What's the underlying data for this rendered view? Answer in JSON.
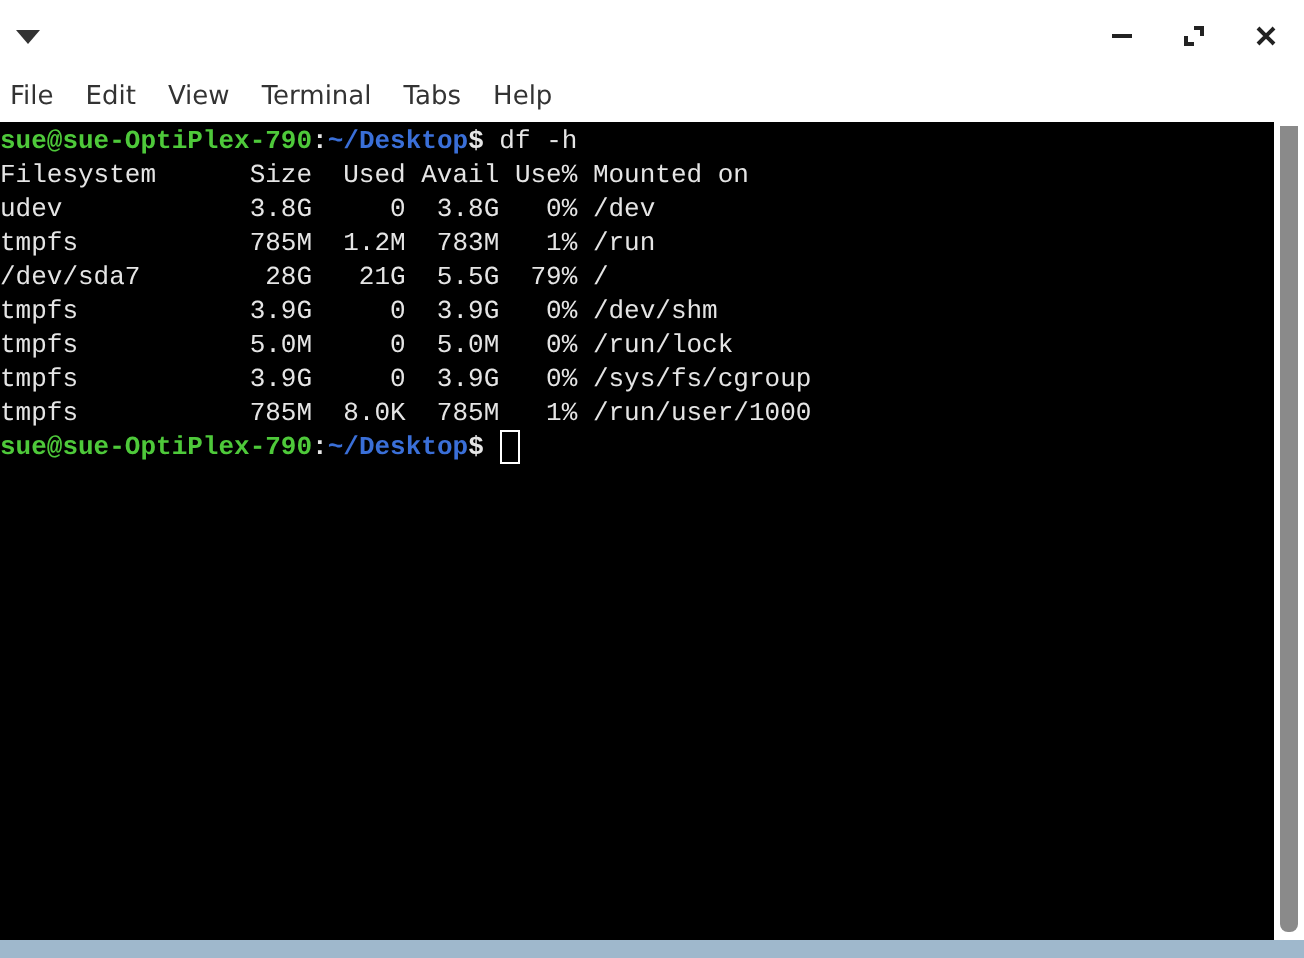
{
  "menu": [
    "File",
    "Edit",
    "View",
    "Terminal",
    "Tabs",
    "Help"
  ],
  "terminal": {
    "lines": [
      {
        "kind": "prompt",
        "user_host": "sue@sue-OptiPlex-790",
        "separator": ":",
        "path": "~/Desktop",
        "symbol": "$",
        "command": " df -h"
      },
      {
        "kind": "output",
        "text": "Filesystem      Size  Used Avail Use% Mounted on"
      },
      {
        "kind": "output",
        "text": "udev            3.8G     0  3.8G   0% /dev"
      },
      {
        "kind": "output",
        "text": "tmpfs           785M  1.2M  783M   1% /run"
      },
      {
        "kind": "output",
        "text": "/dev/sda7        28G   21G  5.5G  79% /"
      },
      {
        "kind": "output",
        "text": "tmpfs           3.9G     0  3.9G   0% /dev/shm"
      },
      {
        "kind": "output",
        "text": "tmpfs           5.0M     0  5.0M   0% /run/lock"
      },
      {
        "kind": "output",
        "text": "tmpfs           3.9G     0  3.9G   0% /sys/fs/cgroup"
      },
      {
        "kind": "output",
        "text": "tmpfs           785M  8.0K  785M   1% /run/user/1000"
      },
      {
        "kind": "prompt",
        "user_host": "sue@sue-OptiPlex-790",
        "separator": ":",
        "path": "~/Desktop",
        "symbol": "$",
        "cursor": true
      }
    ]
  }
}
